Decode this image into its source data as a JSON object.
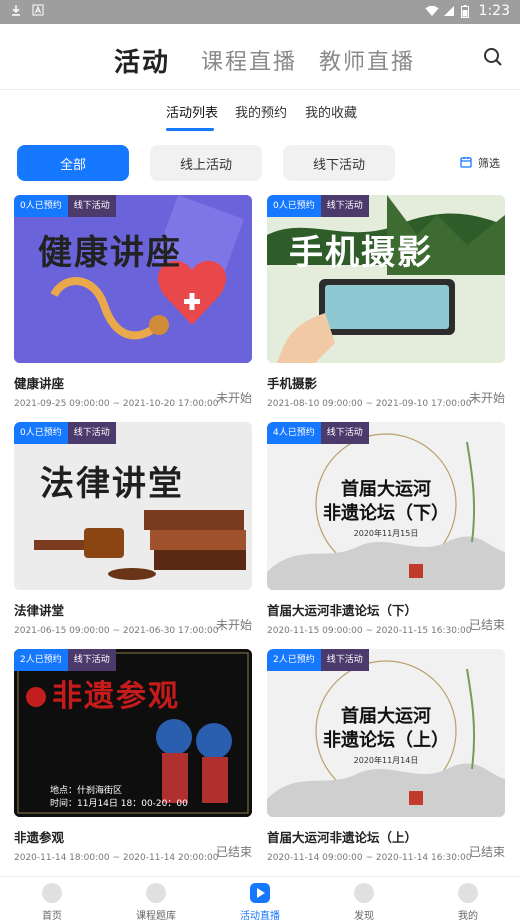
{
  "status_bar": {
    "time": "1:23"
  },
  "header": {
    "tabs": [
      {
        "label": "活动"
      },
      {
        "label": "课程直播"
      },
      {
        "label": "教师直播"
      }
    ]
  },
  "subtabs": [
    {
      "label": "活动列表"
    },
    {
      "label": "我的预约"
    },
    {
      "label": "我的收藏"
    }
  ],
  "filters": {
    "buttons": [
      {
        "label": "全部"
      },
      {
        "label": "线上活动"
      },
      {
        "label": "线下活动"
      }
    ],
    "filter_label": "筛选"
  },
  "cards": [
    {
      "reserved": "0人已预约",
      "type": "线下活动",
      "thumb_text": "健康讲座",
      "title": "健康讲座",
      "dates": "2021-09-25 09:00:00 ~ 2021-10-20 17:00:00",
      "status": "未开始",
      "colors": {
        "bg": "#6b63d9",
        "fg": "#ffffff"
      }
    },
    {
      "reserved": "0人已预约",
      "type": "线下活动",
      "thumb_text": "手机摄影",
      "title": "手机摄影",
      "dates": "2021-08-10 09:00:00 ~ 2021-09-10 17:00:00",
      "status": "未开始",
      "colors": {
        "bg": "#6aa24a",
        "fg": "#ffffff"
      }
    },
    {
      "reserved": "0人已预约",
      "type": "线下活动",
      "thumb_text": "法律讲堂",
      "title": "法律讲堂",
      "dates": "2021-06-15 09:00:00 ~ 2021-06-30 17:00:00",
      "status": "未开始",
      "colors": {
        "bg": "#eaeaea",
        "fg": "#1f1f1f"
      }
    },
    {
      "reserved": "4人已预约",
      "type": "线下活动",
      "thumb_text": "首届大运河\n非遗论坛（下）",
      "thumb_sub": "2020年11月15日",
      "title": "首届大运河非遗论坛（下）",
      "dates": "2020-11-15 09:00:00 ~ 2020-11-15 16:30:00",
      "status": "已结束",
      "colors": {
        "bg": "#efefef",
        "fg": "#111111"
      }
    },
    {
      "reserved": "2人已预约",
      "type": "线下活动",
      "thumb_text": "非遗参观",
      "thumb_sub": "地点：什刹海街区\n时间：11月14日 18：00-20：00",
      "title": "非遗参观",
      "dates": "2020-11-14 18:00:00 ~ 2020-11-14 20:00:00",
      "status": "已结束",
      "colors": {
        "bg": "#111111",
        "fg": "#c51b1b"
      }
    },
    {
      "reserved": "2人已预约",
      "type": "线下活动",
      "thumb_text": "首届大运河\n非遗论坛（上）",
      "thumb_sub": "2020年11月14日",
      "title": "首届大运河非遗论坛（上）",
      "dates": "2020-11-14 09:00:00 ~ 2020-11-14 16:30:00",
      "status": "已结束",
      "colors": {
        "bg": "#efefef",
        "fg": "#111111"
      }
    }
  ],
  "bottom_nav": [
    {
      "label": "首页",
      "icon": "home-icon"
    },
    {
      "label": "课程题库",
      "icon": "question-bank-icon"
    },
    {
      "label": "活动直播",
      "icon": "live-play-icon"
    },
    {
      "label": "发现",
      "icon": "discover-icon"
    },
    {
      "label": "我的",
      "icon": "profile-icon"
    }
  ],
  "colors": {
    "accent": "#1677ff",
    "badge_type": "#4b3a6b"
  }
}
